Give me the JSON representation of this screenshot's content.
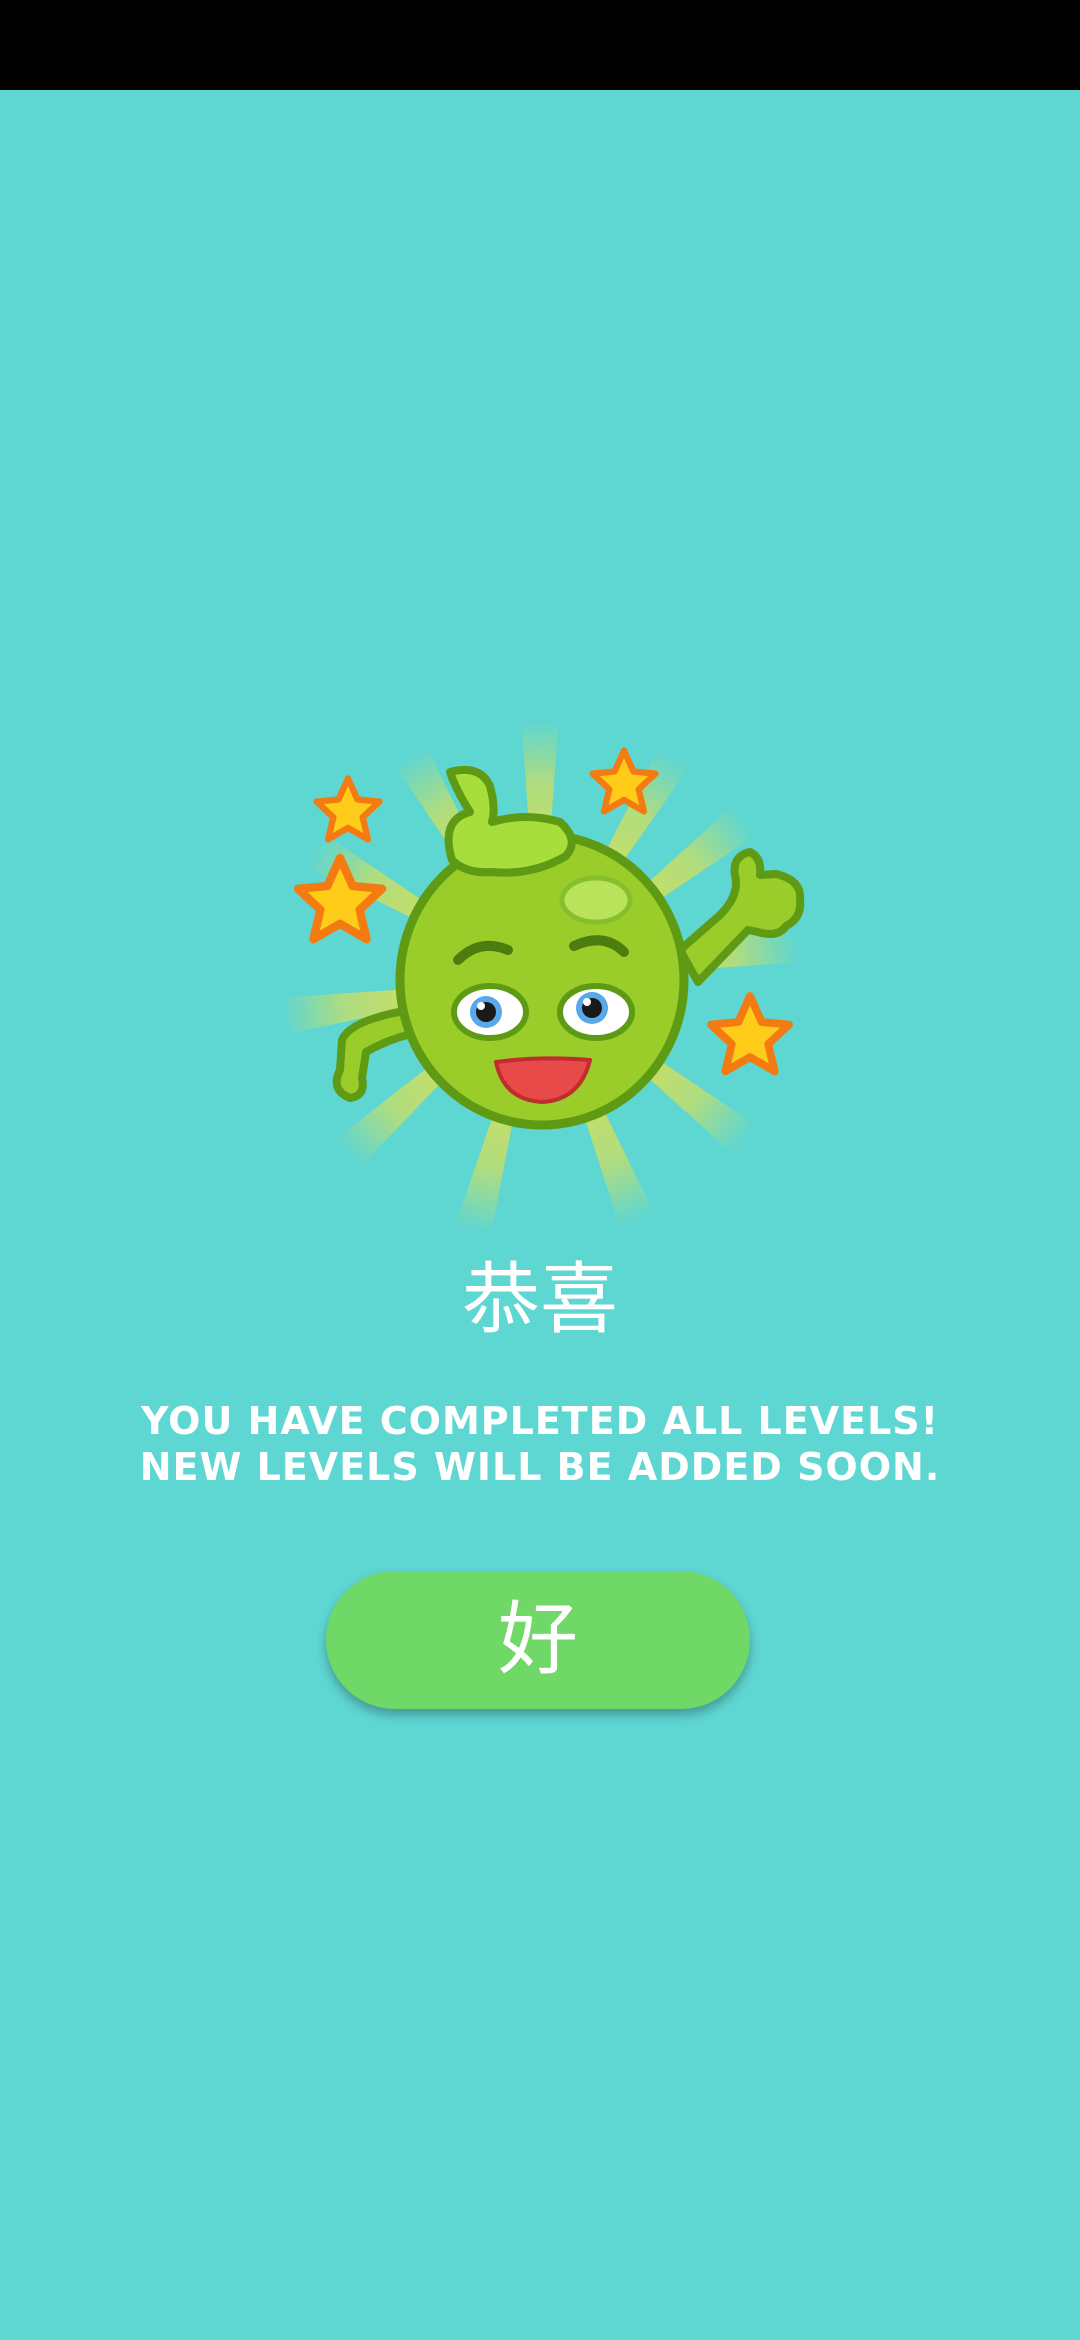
{
  "status_bar": {},
  "celebration": {
    "title": "恭喜",
    "message": "YOU HAVE COMPLETED ALL LEVELS! NEW LEVELS WILL BE ADDED SOON.",
    "ok_label": "好"
  },
  "colors": {
    "background": "#5ed6d2",
    "button": "#6fd866",
    "text": "#ffffff",
    "mascot_body": "#9acd2a",
    "star": "#ffcc1a"
  },
  "icons": [
    "pea-mascot-icon",
    "star-icon",
    "sunburst-icon"
  ]
}
